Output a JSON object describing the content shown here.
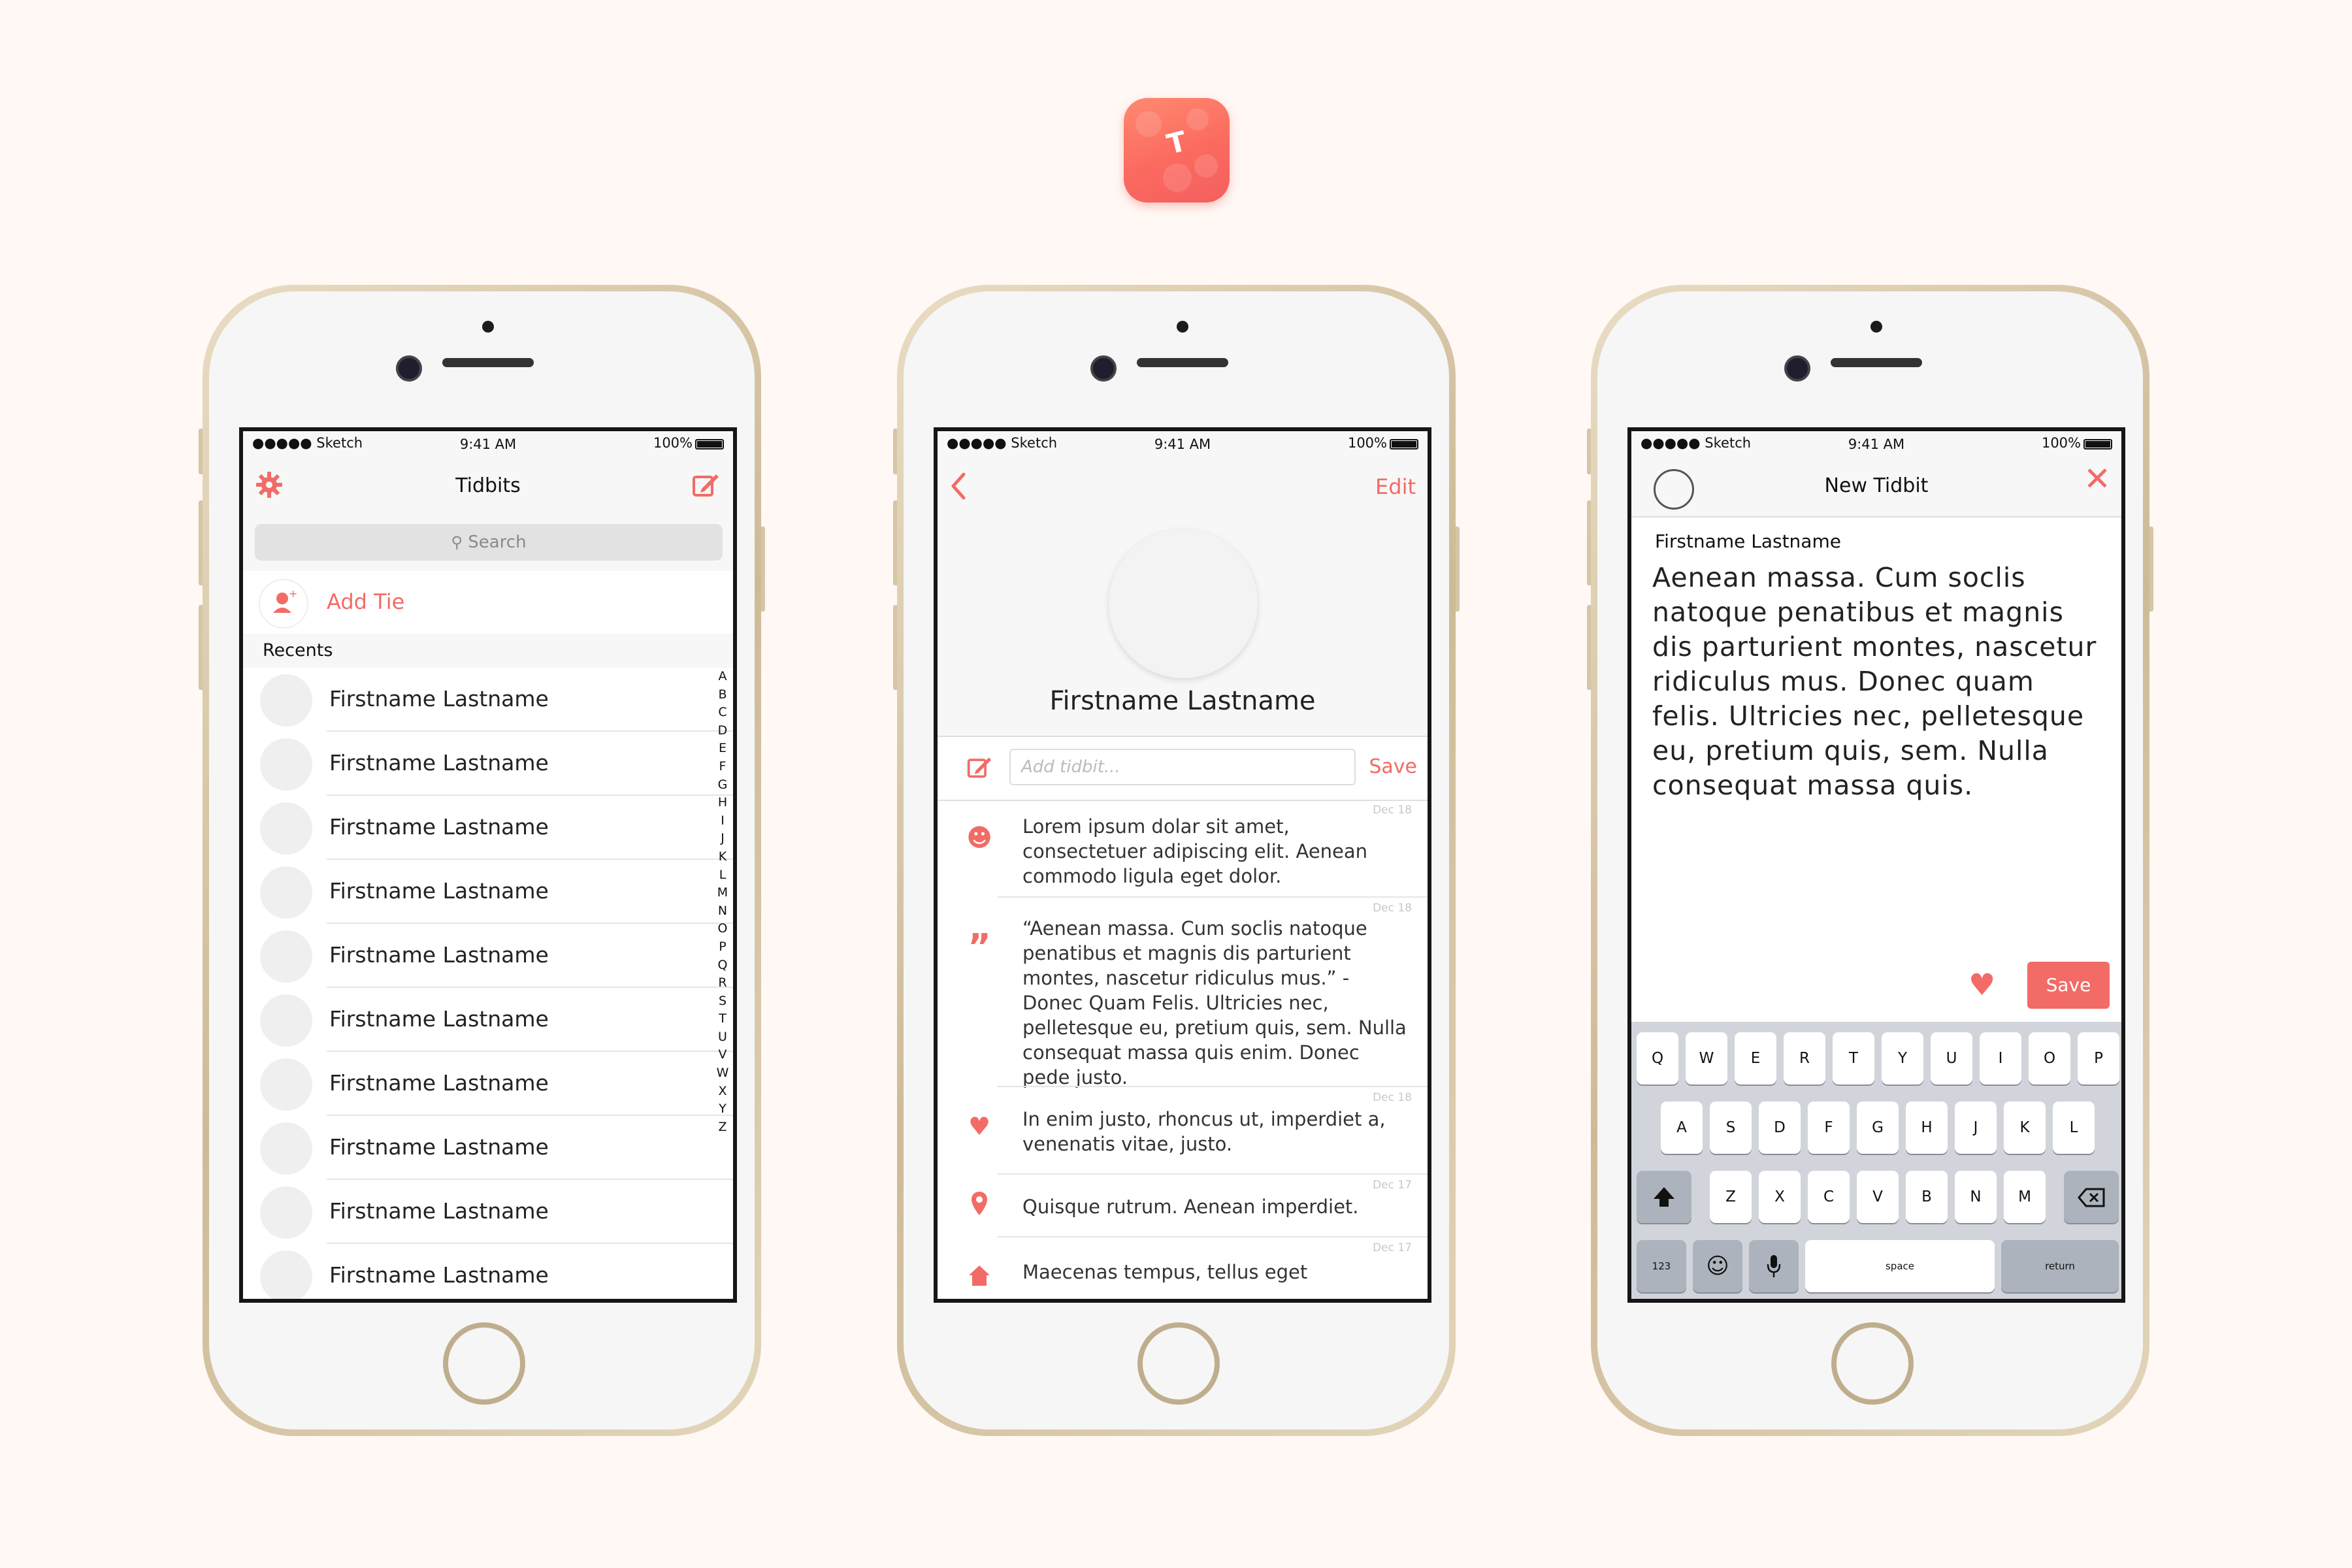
{
  "colors": {
    "accent": "#f26b66",
    "background": "#fff8f5"
  },
  "app_icon": {
    "letter": "T",
    "name": "app-icon"
  },
  "status_bar": {
    "carrier": "●●●●● Sketch",
    "time": "9:41 AM",
    "battery": "100%"
  },
  "screen1": {
    "title": "Tidbits",
    "left_icon": "gear-icon",
    "right_icon": "compose-icon",
    "search_placeholder": "Search",
    "add_tie_label": "Add Tie",
    "section_header": "Recents",
    "contacts": [
      "Firstname Lastname",
      "Firstname Lastname",
      "Firstname Lastname",
      "Firstname Lastname",
      "Firstname Lastname",
      "Firstname Lastname",
      "Firstname Lastname",
      "Firstname Lastname",
      "Firstname Lastname",
      "Firstname Lastname"
    ],
    "alphabet": [
      "A",
      "B",
      "C",
      "D",
      "E",
      "F",
      "G",
      "H",
      "I",
      "J",
      "K",
      "L",
      "M",
      "N",
      "O",
      "P",
      "Q",
      "R",
      "S",
      "T",
      "U",
      "V",
      "W",
      "X",
      "Y",
      "Z"
    ]
  },
  "screen2": {
    "back_icon": "chevron-left-icon",
    "edit_label": "Edit",
    "profile_name": "Firstname Lastname",
    "input_placeholder": "Add tidbit...",
    "save_label": "Save",
    "tidbits": [
      {
        "icon": "smiley-icon",
        "date": "Dec 18",
        "text": "Lorem ipsum dolar sit amet, consectetuer adipiscing elit. Aenean commodo ligula eget dolor."
      },
      {
        "icon": "quote-icon",
        "date": "Dec 18",
        "text": "“Aenean massa. Cum soclis natoque penatibus et magnis dis parturient montes, nascetur ridiculus mus.” - Donec Quam Felis. Ultricies nec, pelletesque eu, pretium quis, sem. Nulla consequat massa quis enim. Donec pede justo."
      },
      {
        "icon": "heart-icon",
        "date": "Dec 18",
        "text": "In enim justo, rhoncus ut, imperdiet a, venenatis vitae, justo."
      },
      {
        "icon": "location-pin-icon",
        "date": "Dec 17",
        "text": "Quisque rutrum. Aenean imperdiet."
      },
      {
        "icon": "home-icon",
        "date": "Dec 17",
        "text": "Maecenas tempus, tellus eget"
      }
    ]
  },
  "screen3": {
    "title": "New Tidbit",
    "recipient": "Firstname Lastname",
    "body": "Aenean massa. Cum soclis natoque penatibus et magnis dis parturient montes, nascetur ridiculus mus. Donec quam felis. Ultricies nec, pelletesque eu, pretium quis, sem. Nulla consequat massa quis.",
    "save_label": "Save",
    "keyboard": {
      "row1": [
        "Q",
        "W",
        "E",
        "R",
        "T",
        "Y",
        "U",
        "I",
        "O",
        "P"
      ],
      "row2": [
        "A",
        "S",
        "D",
        "F",
        "G",
        "H",
        "J",
        "K",
        "L"
      ],
      "row3": [
        "Z",
        "X",
        "C",
        "V",
        "B",
        "N",
        "M"
      ],
      "numbers_key": "123",
      "space_key": "space",
      "return_key": "return"
    }
  }
}
